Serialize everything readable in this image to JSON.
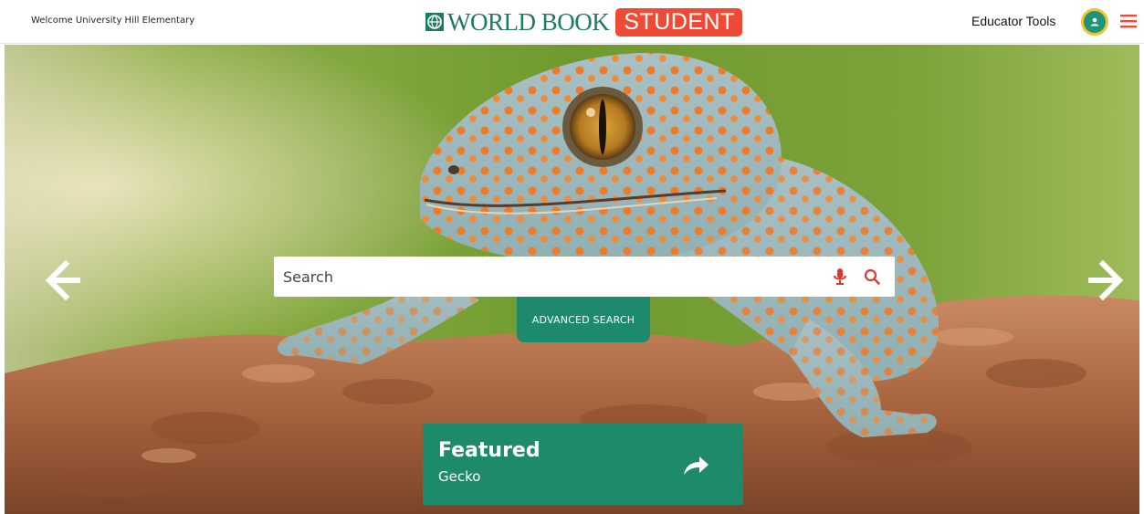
{
  "header": {
    "welcome_text": "Welcome University Hill Elementary",
    "logo": {
      "wordmark": "WORLD BOOK",
      "badge": "STUDENT",
      "icon": "world-book-globe-logo"
    },
    "educator_tools_label": "Educator Tools",
    "avatar_icon": "user-avatar-icon",
    "menu_icon": "hamburger-menu-icon"
  },
  "hero": {
    "image_subject": "gecko",
    "prev_icon": "arrow-left-icon",
    "next_icon": "arrow-right-icon"
  },
  "search": {
    "placeholder": "Search",
    "value": "",
    "mic_icon": "microphone-icon",
    "search_icon": "search-icon",
    "advanced_label": "ADVANCED SEARCH"
  },
  "featured": {
    "title": "Featured",
    "subtitle": "Gecko",
    "icon": "share-arrow-icon"
  },
  "colors": {
    "brand_green": "#1e8a6c",
    "brand_red": "#ef4a35",
    "avatar_ring": "#f2c233"
  }
}
